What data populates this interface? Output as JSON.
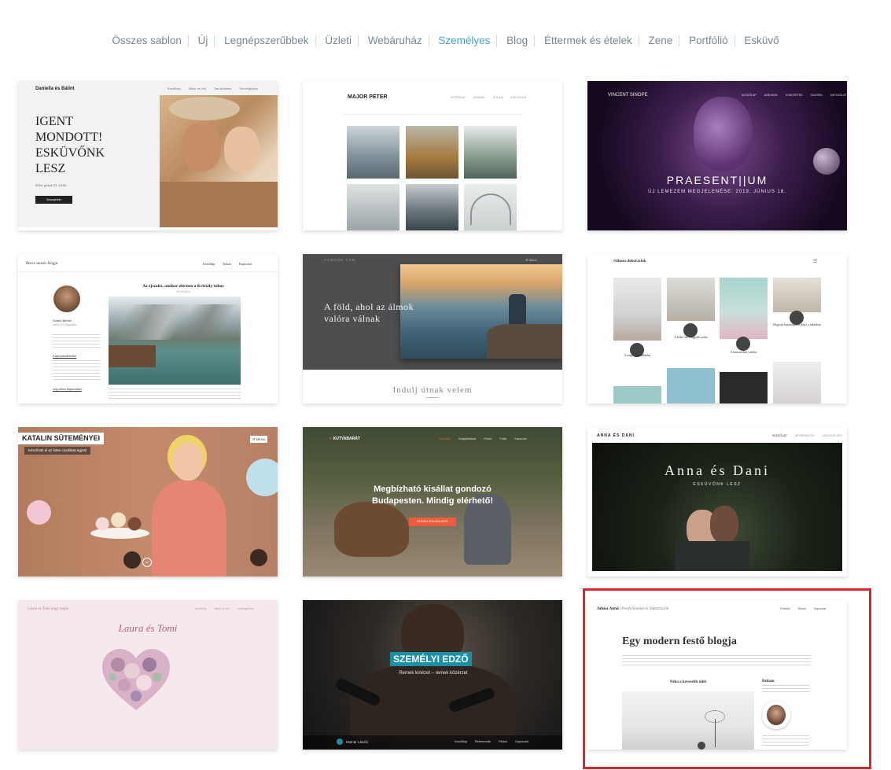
{
  "nav": {
    "items": [
      "Összes sablon",
      "Új",
      "Legnépszerűbbek",
      "Üzleti",
      "Webáruház",
      "Személyes",
      "Blog",
      "Éttermek és ételek",
      "Zene",
      "Portfólió",
      "Esküvő"
    ],
    "active": "Személyes",
    "active_color": "#4a9fd8"
  },
  "templates": {
    "t1": {
      "brand": "Daniella és Bálint",
      "menu": [
        "Kezdőlap",
        "Mikor és Hol",
        "Tanúkövetés",
        "Vendégkönyv"
      ],
      "headline": "IGENT MONDOTT! ESKÜVŐNK LESZ",
      "date": "2019. június 23. 13:00",
      "button": "Visszajelzés"
    },
    "t2": {
      "brand": "MAJOR PÉTER",
      "menu": [
        "KEZDŐLAP",
        "MUNKÁK",
        "RÓLAM",
        "KAPCSOLAT"
      ]
    },
    "t3": {
      "brand": "VINCENT SINOPE",
      "menu": [
        "KEZDŐLAP",
        "ALBUMOK",
        "KONCERTEK",
        "GALÉRIA",
        "KAPCSOLAT"
      ],
      "headline": "PRAESENT||UM",
      "sub": "ÚJ LEMEZEM MEGJELENÉSE: 2019. JÚNIUS 18."
    },
    "t4": {
      "brand": "Bence utazós blogja",
      "menu": [
        "Kezdőlap",
        "Rólam",
        "Kapcsolat"
      ],
      "post_title": "Az éjszaka, amikor elértem a Kristály-tóhoz",
      "post_date": "06.20.2019",
      "author": "Szabó Bence",
      "author_role": "Utazó & Fotográfus",
      "contact_heading": "Kapcsolatfelvétel",
      "more_link": "Lépj velem kapcsolatba"
    },
    "t5": {
      "brand": "VÁNDOR TOM",
      "menu_label": "☰ Menü",
      "headline": "A föld, ahol az álmok valóra válnak",
      "footer": "Indulj útnak velem"
    },
    "t6": {
      "brand": "Stílusos dekorációk",
      "posts": [
        "A nappali kialakítása",
        "A belső tér 5 legjobb színe",
        "A kanszerkek vanilia",
        "Hogyan használjuk a fényt a lakásban"
      ]
    },
    "t7": {
      "brand": "KATALIN SÜTEMÉNYEI",
      "tagline": "Készítsük el az édes csodákat együtt",
      "menu_label": "☰ MENÜ"
    },
    "t8": {
      "brand": "KUTYABARÁT",
      "menu": [
        "Kezdőlap",
        "Szolgáltatások",
        "Rólam",
        "Fotók",
        "Kapcsolat"
      ],
      "headline": "Megbízható kisállat gondozó Budapesten. Mindig elérhető!",
      "button": "KÉRJEN ÁRAJÁNLATOT"
    },
    "t9": {
      "brand": "ANNA ÉS DANI",
      "menu": [
        "KEZDŐLAP",
        "INFORMÁCIÓK",
        "VISSZAJELZÉS"
      ],
      "headline": "Anna és Dani",
      "sub": "ESKÜVŐNK LESZ"
    },
    "t10": {
      "brand": "Laura és Tomi nagy napja",
      "menu": [
        "Kezdőlap",
        "Mikor és Hol",
        "Vendégkönyv"
      ],
      "headline": "Laura és Tomi"
    },
    "t11": {
      "headline": "SZEMÉLYI EDZŐ",
      "sub": "Remek kinézet – remek közérzet",
      "footer_brand": "Molnár László",
      "menu": [
        "Kezdőlap",
        "Referenciák",
        "Rólam",
        "Kapcsolat"
      ]
    },
    "t12": {
      "brand": "Juhász Antal",
      "brand_sub": "Portfolióoldal és illusztrációk",
      "menu": [
        "Portfólió",
        "Rólam",
        "Kapcsolat"
      ],
      "headline": "Egy modern festő blogja",
      "post_title": "Néha a kevesebb több",
      "sidebar_heading": "Rólam"
    }
  },
  "colors": {
    "selection_border": "#e0242b",
    "nav_text": "#7a8794",
    "coral": "#f05a3e",
    "teal": "#1a8fa6"
  }
}
